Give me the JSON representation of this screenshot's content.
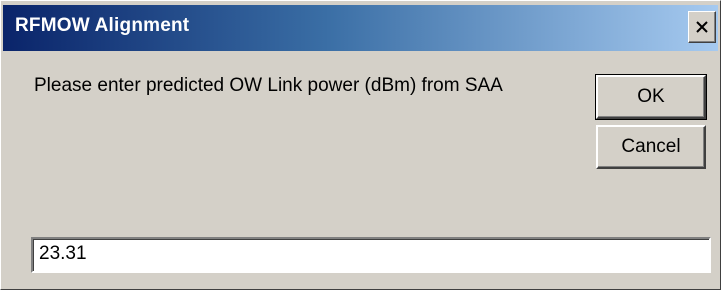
{
  "window": {
    "title": "RFMOW Alignment",
    "close_icon": "close-icon"
  },
  "dialog": {
    "prompt": "Please enter predicted OW Link power (dBm) from SAA",
    "ok_label": "OK",
    "cancel_label": "Cancel",
    "input_value": "23.31"
  }
}
